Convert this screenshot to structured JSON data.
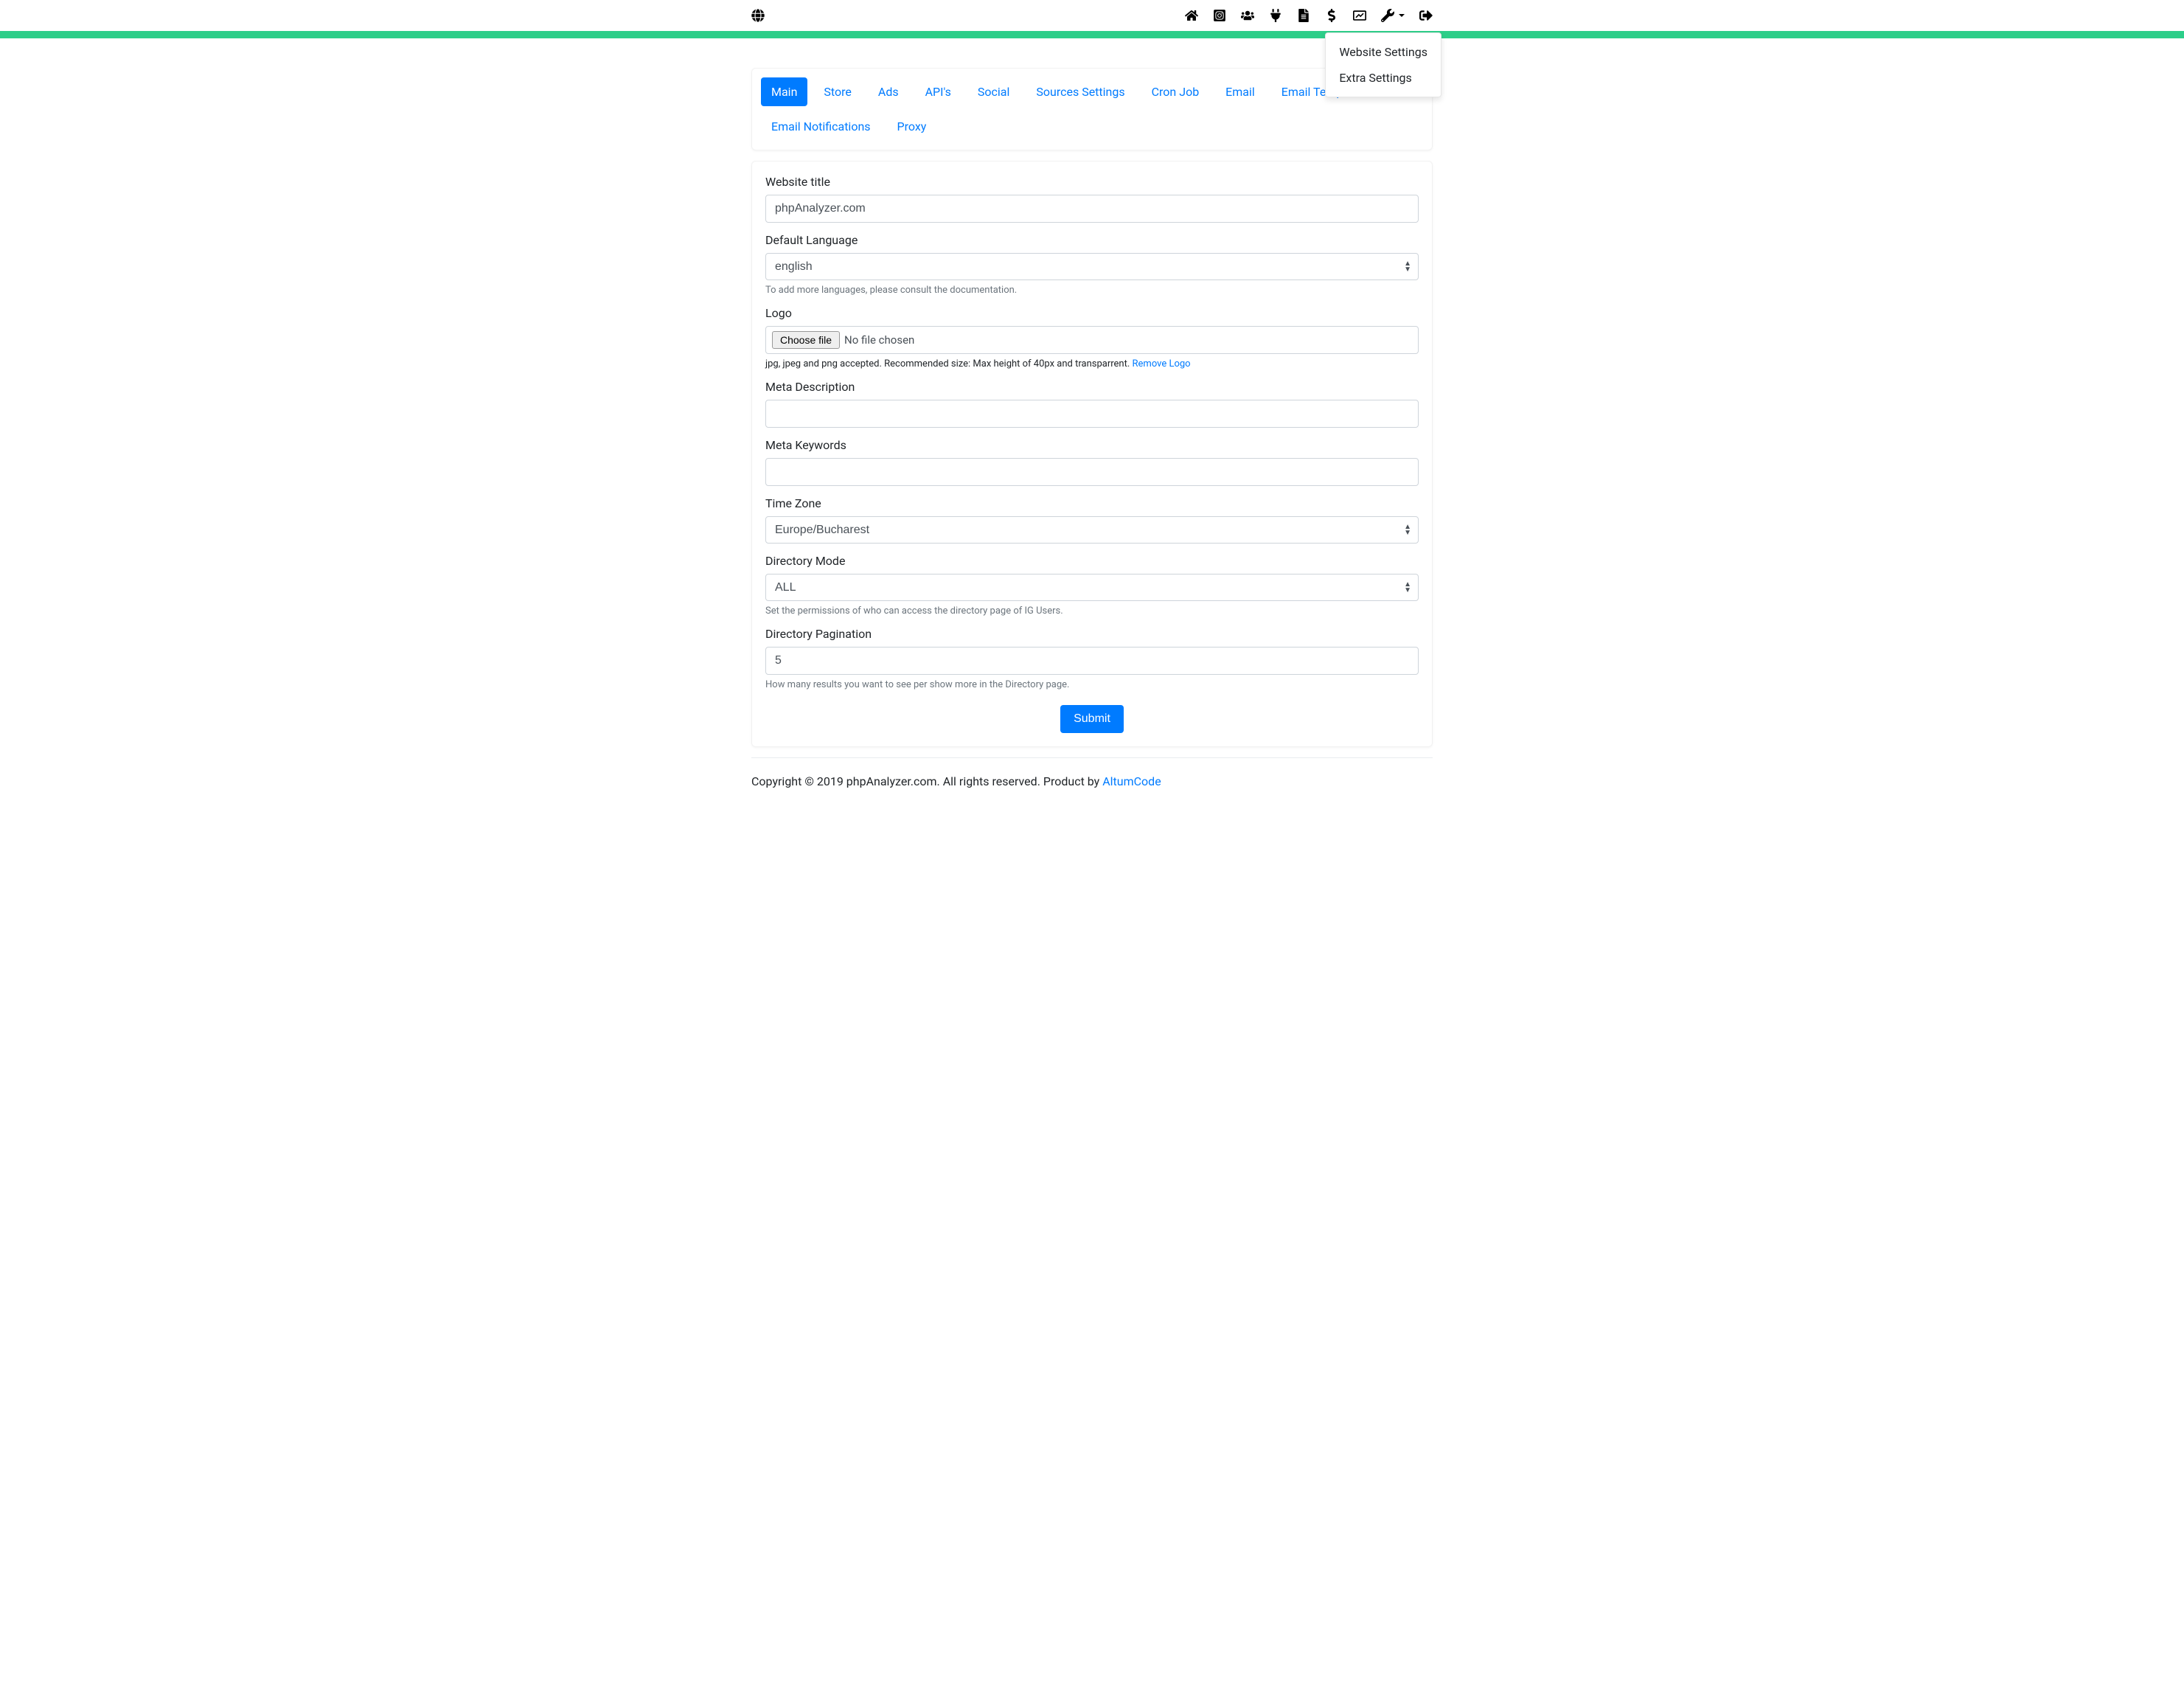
{
  "dropdown": {
    "items": [
      {
        "label": "Website Settings"
      },
      {
        "label": "Extra Settings"
      }
    ]
  },
  "tabs": [
    {
      "label": "Main",
      "active": true
    },
    {
      "label": "Store",
      "active": false
    },
    {
      "label": "Ads",
      "active": false
    },
    {
      "label": "API's",
      "active": false
    },
    {
      "label": "Social",
      "active": false
    },
    {
      "label": "Sources Settings",
      "active": false
    },
    {
      "label": "Cron Job",
      "active": false
    },
    {
      "label": "Email",
      "active": false
    },
    {
      "label": "Email Templates",
      "active": false
    },
    {
      "label": "Email Notifications",
      "active": false
    },
    {
      "label": "Proxy",
      "active": false
    }
  ],
  "form": {
    "website_title": {
      "label": "Website title",
      "value": "phpAnalyzer.com"
    },
    "default_language": {
      "label": "Default Language",
      "value": "english",
      "help": "To add more languages, please consult the documentation."
    },
    "logo": {
      "label": "Logo",
      "button": "Choose file",
      "no_file": "No file chosen",
      "help": "jpg, jpeg and png accepted. Recommended size: Max height of 40px and transparrent. ",
      "remove_link": "Remove Logo"
    },
    "meta_description": {
      "label": "Meta Description",
      "value": ""
    },
    "meta_keywords": {
      "label": "Meta Keywords",
      "value": ""
    },
    "time_zone": {
      "label": "Time Zone",
      "value": "Europe/Bucharest"
    },
    "directory_mode": {
      "label": "Directory Mode",
      "value": "ALL",
      "help": "Set the permissions of who can access the directory page of IG Users."
    },
    "directory_pagination": {
      "label": "Directory Pagination",
      "value": "5",
      "help": "How many results you want to see per show more in the Directory page."
    },
    "submit_label": "Submit"
  },
  "footer": {
    "text": "Copyright © 2019 phpAnalyzer.com. All rights reserved. Product by ",
    "link": "AltumCode"
  }
}
